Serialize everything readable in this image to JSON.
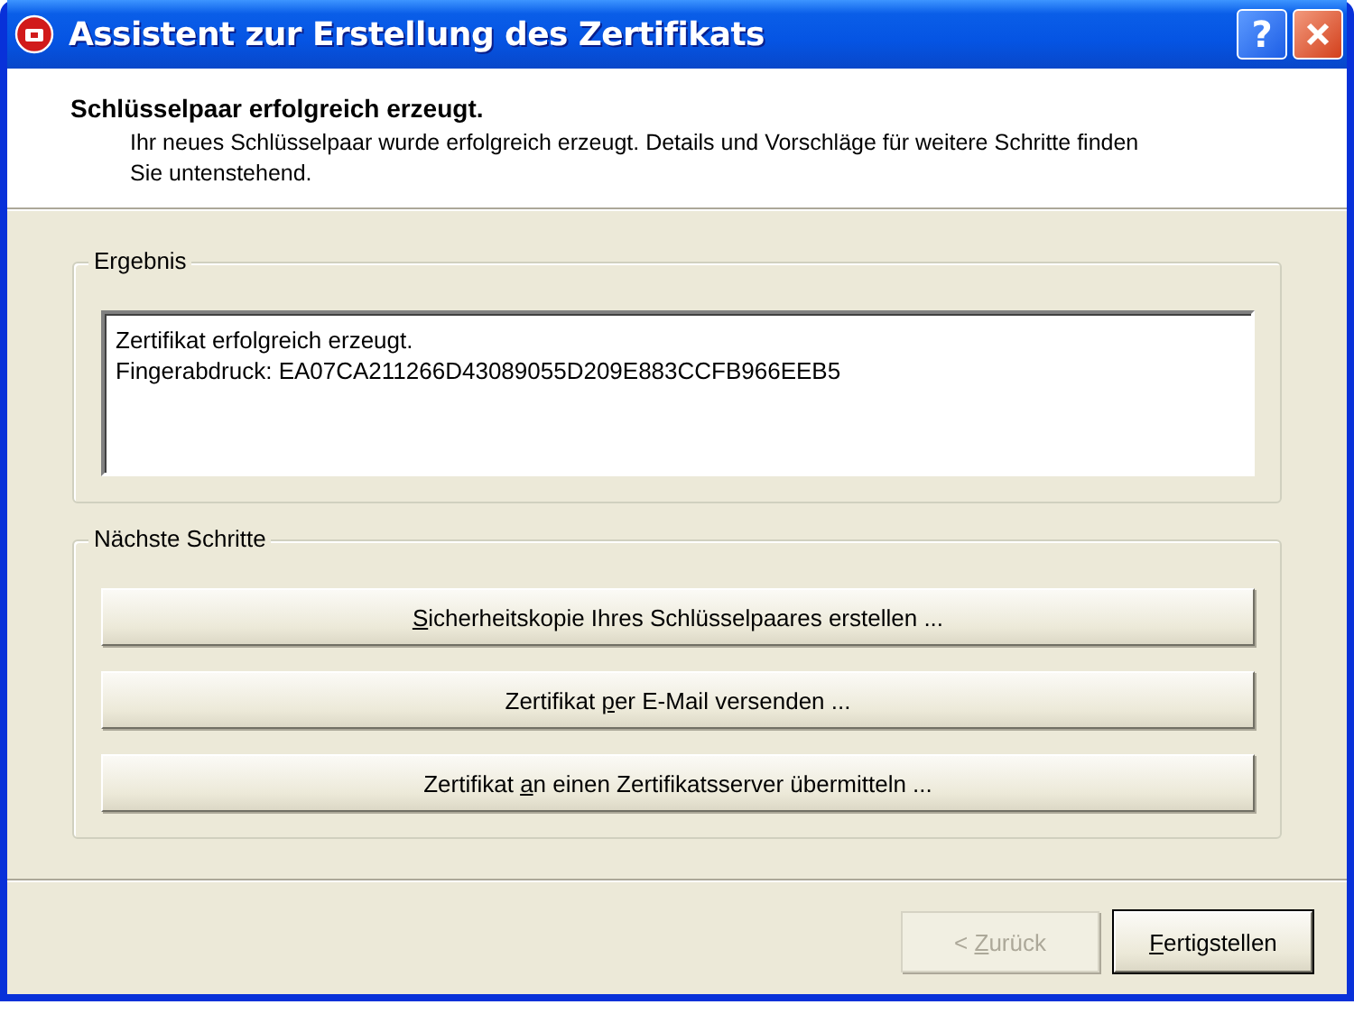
{
  "window": {
    "title": "Assistent zur Erstellung des Zertifikats",
    "title_buttons": [
      {
        "kind": "help",
        "label": "?"
      },
      {
        "kind": "close"
      }
    ]
  },
  "header": {
    "title": "Schlüsselpaar erfolgreich erzeugt.",
    "description": "Ihr neues Schlüsselpaar wurde erfolgreich erzeugt. Details und Vorschläge für weitere Schritte finden Sie untenstehend."
  },
  "result": {
    "label": "Ergebnis",
    "lines": [
      "Zertifikat erfolgreich erzeugt.",
      "Fingerabdruck: EA07CA211266D43089055D209E883CCFB966EEB5"
    ]
  },
  "next_steps": {
    "label": "Nächste Schritte",
    "buttons": [
      {
        "access_key": "S",
        "label_post": "icherheitskopie Ihres Schlüsselpaares erstellen ..."
      },
      {
        "label_pre": "Zertifikat ",
        "access_key": "p",
        "label_post": "er E-Mail versenden ..."
      },
      {
        "label_pre": "Zertifikat ",
        "access_key": "a",
        "label_post": "n einen Zertifikatsserver übermitteln ..."
      }
    ]
  },
  "footer_buttons": [
    {
      "label_pre": "< ",
      "access_key": "Z",
      "label_post": "urück",
      "disabled": true,
      "default": false
    },
    {
      "access_key": "F",
      "label_post": "ertigstellen",
      "disabled": false,
      "default": true
    }
  ]
}
